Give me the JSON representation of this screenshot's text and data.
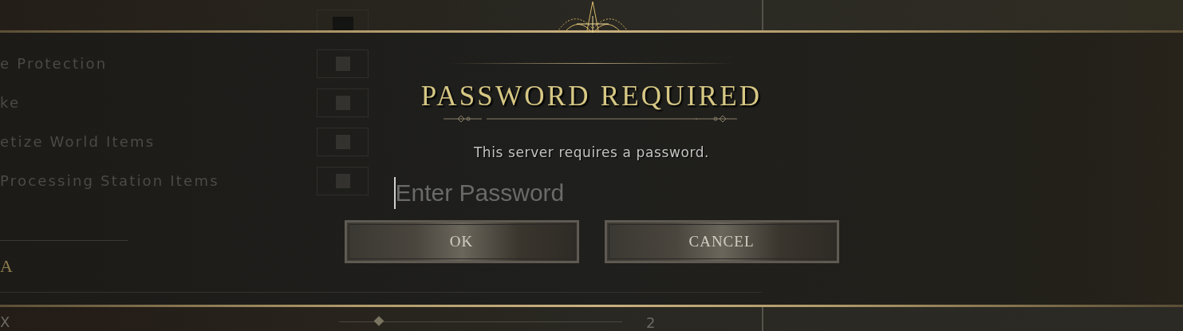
{
  "background": {
    "top_checkbox": {
      "checked": false
    },
    "rows": [
      {
        "label": "e Protection",
        "kind": "checkbox",
        "checked": false
      },
      {
        "label": "ke",
        "kind": "checkbox",
        "checked": false
      },
      {
        "label": "etize World Items",
        "kind": "checkbox",
        "checked": false
      },
      {
        "label": "Processing Station Items",
        "kind": "checkbox",
        "checked": false
      }
    ],
    "section_heading": "A",
    "slider": {
      "label": "X",
      "level": 0.14,
      "value": "2"
    }
  },
  "dialog": {
    "title": "PASSWORD REQUIRED",
    "message": "This server requires a password.",
    "password": {
      "placeholder": "Enter Password"
    },
    "buttons": [
      {
        "label": "OK"
      },
      {
        "label": "CANCEL"
      }
    ]
  }
}
